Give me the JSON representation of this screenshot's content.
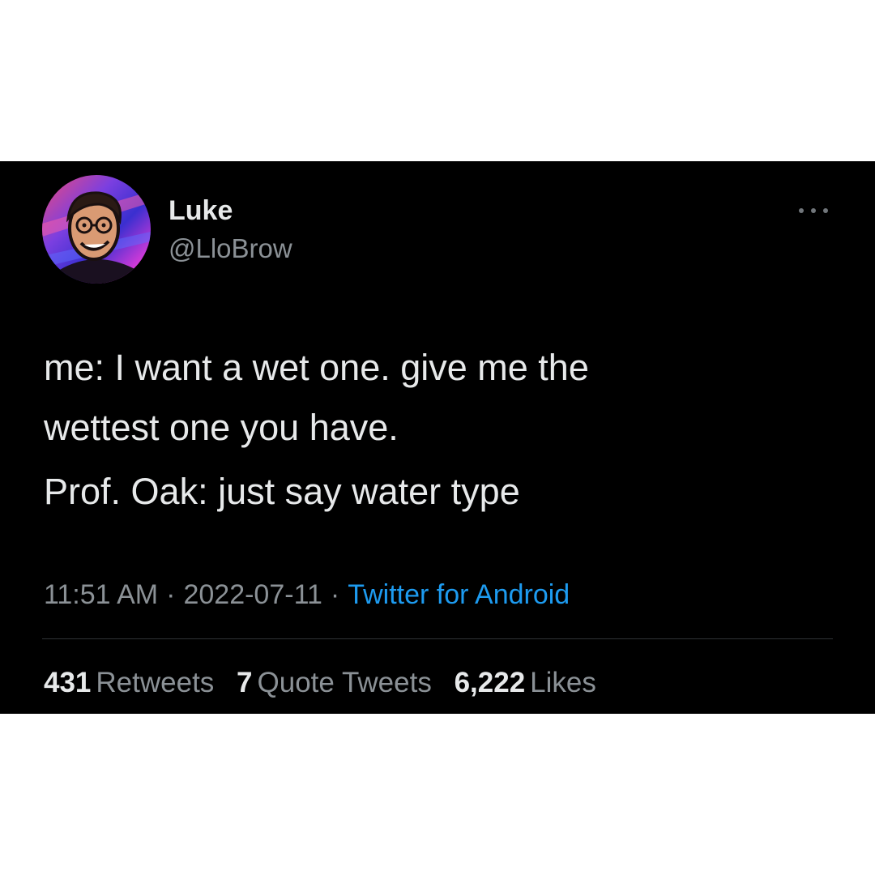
{
  "tweet": {
    "author": {
      "display_name": "Luke",
      "handle": "@LloBrow"
    },
    "paragraphs": [
      "me: I want a wet one. give me the\nwettest one you have.",
      "Prof. Oak: just say water type"
    ],
    "timestamp": {
      "time": "11:51 AM",
      "separator": "·",
      "date": "2022-07-11",
      "source": "Twitter for Android"
    },
    "stats": {
      "retweets": {
        "count": "431",
        "label": "Retweets"
      },
      "quotes": {
        "count": "7",
        "label": "Quote Tweets"
      },
      "likes": {
        "count": "6,222",
        "label": "Likes"
      }
    },
    "more_icon": "more-horizontal-icon"
  },
  "colors": {
    "background": "#000000",
    "text_primary": "#e7e9ea",
    "text_secondary": "#8b9196",
    "link": "#1d9bf0",
    "divider": "#2f3336"
  }
}
